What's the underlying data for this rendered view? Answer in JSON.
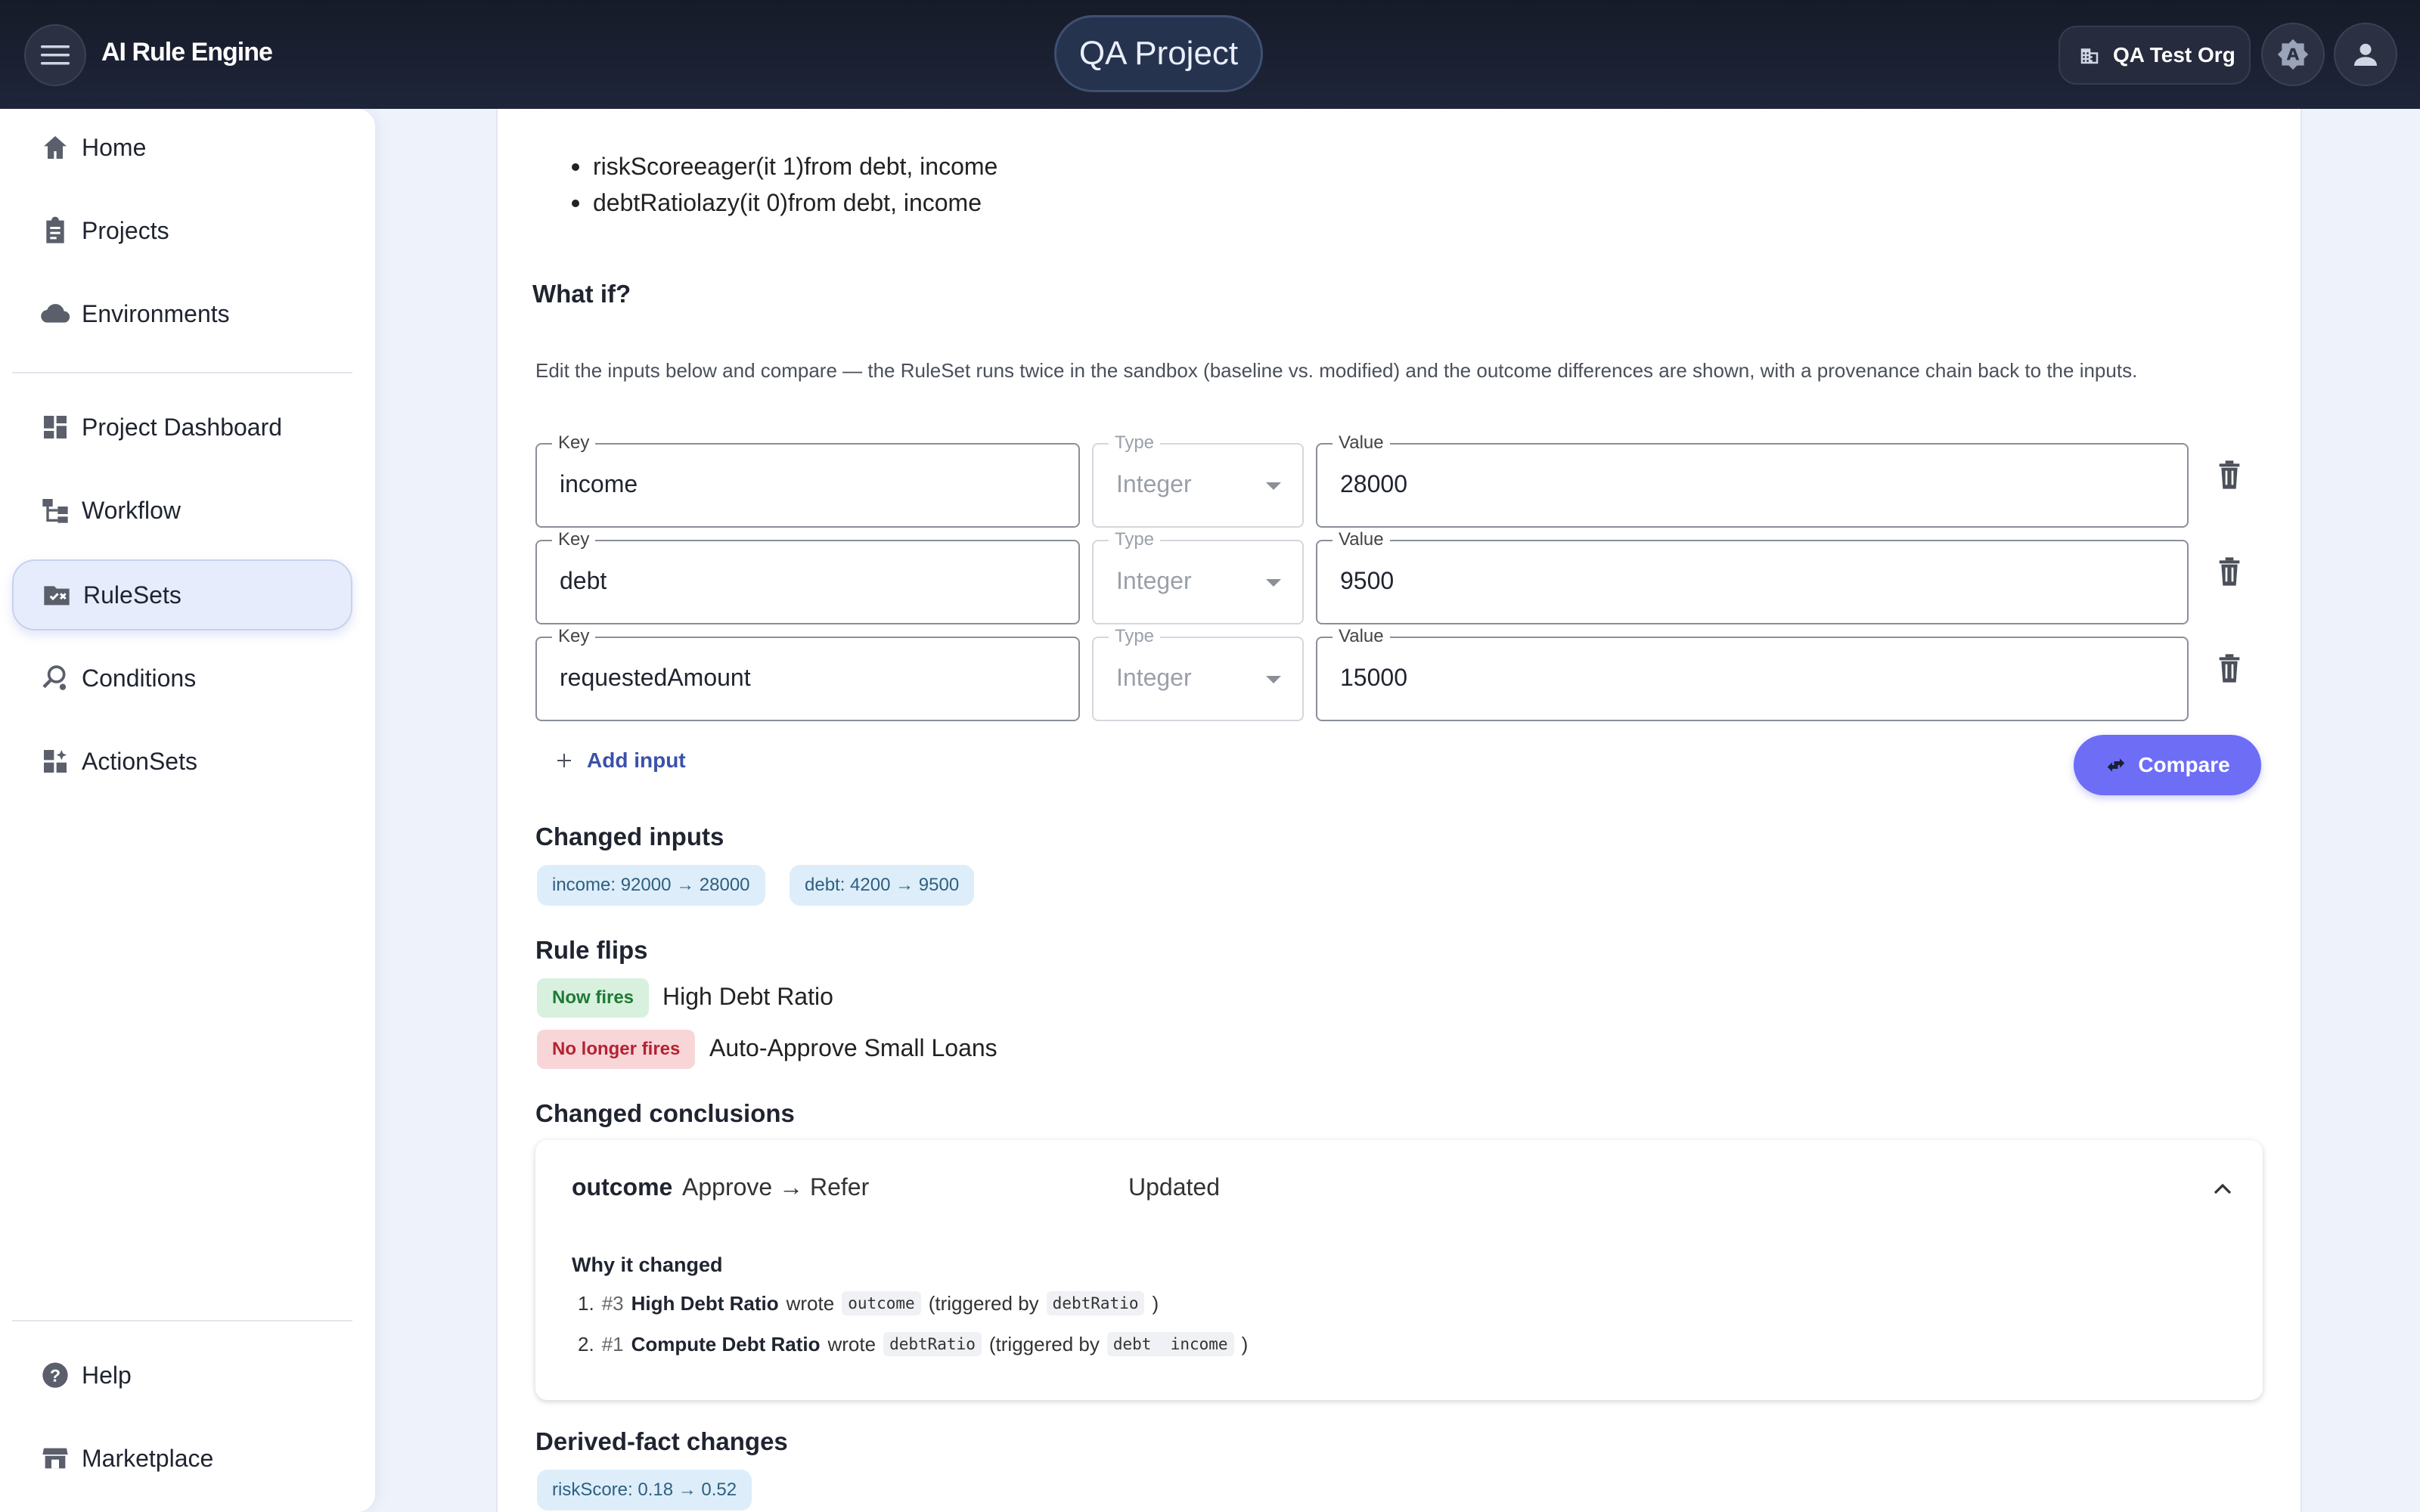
{
  "header": {
    "brand": "AI Rule Engine",
    "project": "QA Project",
    "org": "QA Test Org"
  },
  "sidebar": {
    "items": [
      {
        "label": "Home",
        "icon": "home-icon"
      },
      {
        "label": "Projects",
        "icon": "clipboard-icon"
      },
      {
        "label": "Environments",
        "icon": "cloud-icon"
      },
      {
        "label": "Project Dashboard",
        "icon": "dashboard-icon"
      },
      {
        "label": "Workflow",
        "icon": "workflow-icon"
      },
      {
        "label": "RuleSets",
        "icon": "ruleset-icon",
        "active": true
      },
      {
        "label": "Conditions",
        "icon": "conditions-icon"
      },
      {
        "label": "ActionSets",
        "icon": "actionsets-icon"
      },
      {
        "label": "Help",
        "icon": "help-icon"
      },
      {
        "label": "Marketplace",
        "icon": "store-icon"
      }
    ]
  },
  "facts": [
    "riskScoreeager(it 1)from debt, income",
    "debtRatiolazy(it 0)from debt, income"
  ],
  "whatif": {
    "title": "What if?",
    "description": "Edit the inputs below and compare — the RuleSet runs twice in the sandbox (baseline vs. modified) and the outcome differences are shown, with a provenance chain back to the inputs.",
    "labels": {
      "key": "Key",
      "type": "Type",
      "value": "Value"
    },
    "inputs": [
      {
        "key": "income",
        "type": "Integer",
        "value": "28000"
      },
      {
        "key": "debt",
        "type": "Integer",
        "value": "9500"
      },
      {
        "key": "requestedAmount",
        "type": "Integer",
        "value": "15000"
      }
    ],
    "add_label": "Add input",
    "compare_label": "Compare"
  },
  "changed_inputs": {
    "title": "Changed inputs",
    "chips": [
      "income: 92000 → 28000",
      "debt: 4200 → 9500"
    ]
  },
  "rule_flips": {
    "title": "Rule flips",
    "items": [
      {
        "badge": "Now fires",
        "rule": "High Debt Ratio",
        "status_color": "#1f7a35"
      },
      {
        "badge": "No longer fires",
        "rule": "Auto-Approve Small Loans",
        "status_color": "#b42233"
      }
    ]
  },
  "changed_conclusions": {
    "title": "Changed conclusions",
    "key": "outcome",
    "change": "Approve → Refer",
    "status": "Updated",
    "why_title": "Why it changed",
    "provenance": [
      {
        "n": "1.",
        "hash": "#3",
        "rule": "High Debt Ratio",
        "wrote": "wrote",
        "field": "outcome",
        "trig": "(triggered by",
        "by": [
          "debtRatio"
        ],
        "close": ")"
      },
      {
        "n": "2.",
        "hash": "#1",
        "rule": "Compute Debt Ratio",
        "wrote": "wrote",
        "field": "debtRatio",
        "trig": "(triggered by",
        "by": [
          "debt",
          "income"
        ],
        "close": ")"
      }
    ]
  },
  "derived": {
    "title": "Derived-fact changes",
    "chips": [
      "riskScore: 0.18 → 0.52"
    ]
  }
}
